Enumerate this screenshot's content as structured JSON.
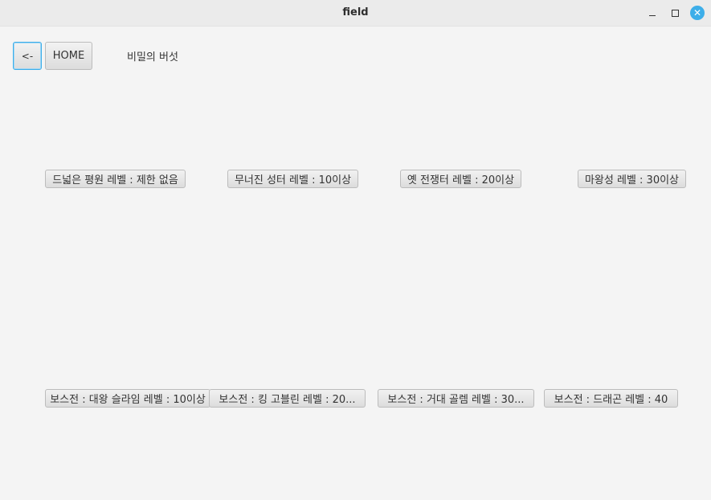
{
  "window": {
    "title": "field"
  },
  "toolbar": {
    "back_label": "<-",
    "home_label": "HOME",
    "item_label": "비밀의 버섯"
  },
  "fields": [
    {
      "label": "드넓은 평원 레벨 : 제한 없음"
    },
    {
      "label": "무너진 성터 레벨 : 10이상"
    },
    {
      "label": "옛 전쟁터 레벨 : 20이상"
    },
    {
      "label": "마왕성 레벨 : 30이상"
    }
  ],
  "bosses": [
    {
      "label": "보스전 : 대왕 슬라임 레벨 : 10이상"
    },
    {
      "label": "보스전 : 킹 고블린 레벨 : 20..."
    },
    {
      "label": "보스전 : 거대 골렘 레벨 : 30..."
    },
    {
      "label": "보스전 : 드래곤 레벨 : 40"
    }
  ],
  "colors": {
    "accent": "#3daee9",
    "background": "#f4f4f4"
  }
}
